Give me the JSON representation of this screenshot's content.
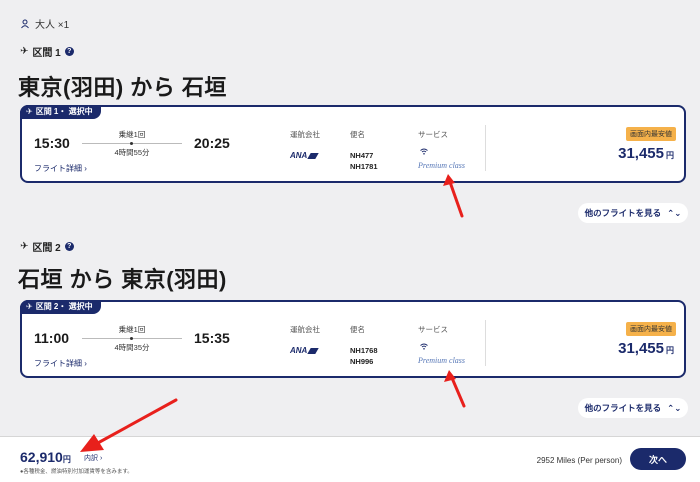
{
  "passenger": {
    "label": "大人 ×1"
  },
  "segments": [
    {
      "label": "区間 1",
      "route_title": "東京(羽田) から 石垣",
      "tab": "区間 1・ 選択中",
      "dep": "15:30",
      "arr": "20:25",
      "stops": "乗継1回",
      "duration": "4時間55分",
      "detail_link": "フライト詳細",
      "operator_header": "運航会社",
      "operator": "ANA",
      "flight_header": "便名",
      "flights": [
        "NH477",
        "NH1781"
      ],
      "service_header": "サービス",
      "service": "Premium class",
      "badge": "画面内最安値",
      "price": "31,455",
      "price_unit": "円",
      "other_flights": "他のフライトを見る"
    },
    {
      "label": "区間 2",
      "route_title": "石垣 から 東京(羽田)",
      "tab": "区間 2・ 選択中",
      "dep": "11:00",
      "arr": "15:35",
      "stops": "乗継1回",
      "duration": "4時間35分",
      "detail_link": "フライト詳細",
      "operator_header": "運航会社",
      "operator": "ANA",
      "flight_header": "便名",
      "flights": [
        "NH1768",
        "NH996"
      ],
      "service_header": "サービス",
      "service": "Premium class",
      "badge": "画面内最安値",
      "price": "31,455",
      "price_unit": "円",
      "other_flights": "他のフライトを見る"
    }
  ],
  "footer": {
    "total": "62,910",
    "total_unit": "円",
    "breakdown": "内訳",
    "tax_note": "●各種税金、燃油特別付加運賃等を含みます。",
    "miles": "2952 Miles (Per person)",
    "next": "次へ"
  },
  "colors": {
    "brand": "#1b2a6b",
    "badge": "#f5b14a",
    "annotation_arrow": "#e8201c"
  },
  "icons": [
    "person-icon",
    "plane-icon",
    "help-icon",
    "wifi-icon",
    "chevron-right-icon",
    "chevron-updown-icon",
    "red-arrow-annotation"
  ]
}
